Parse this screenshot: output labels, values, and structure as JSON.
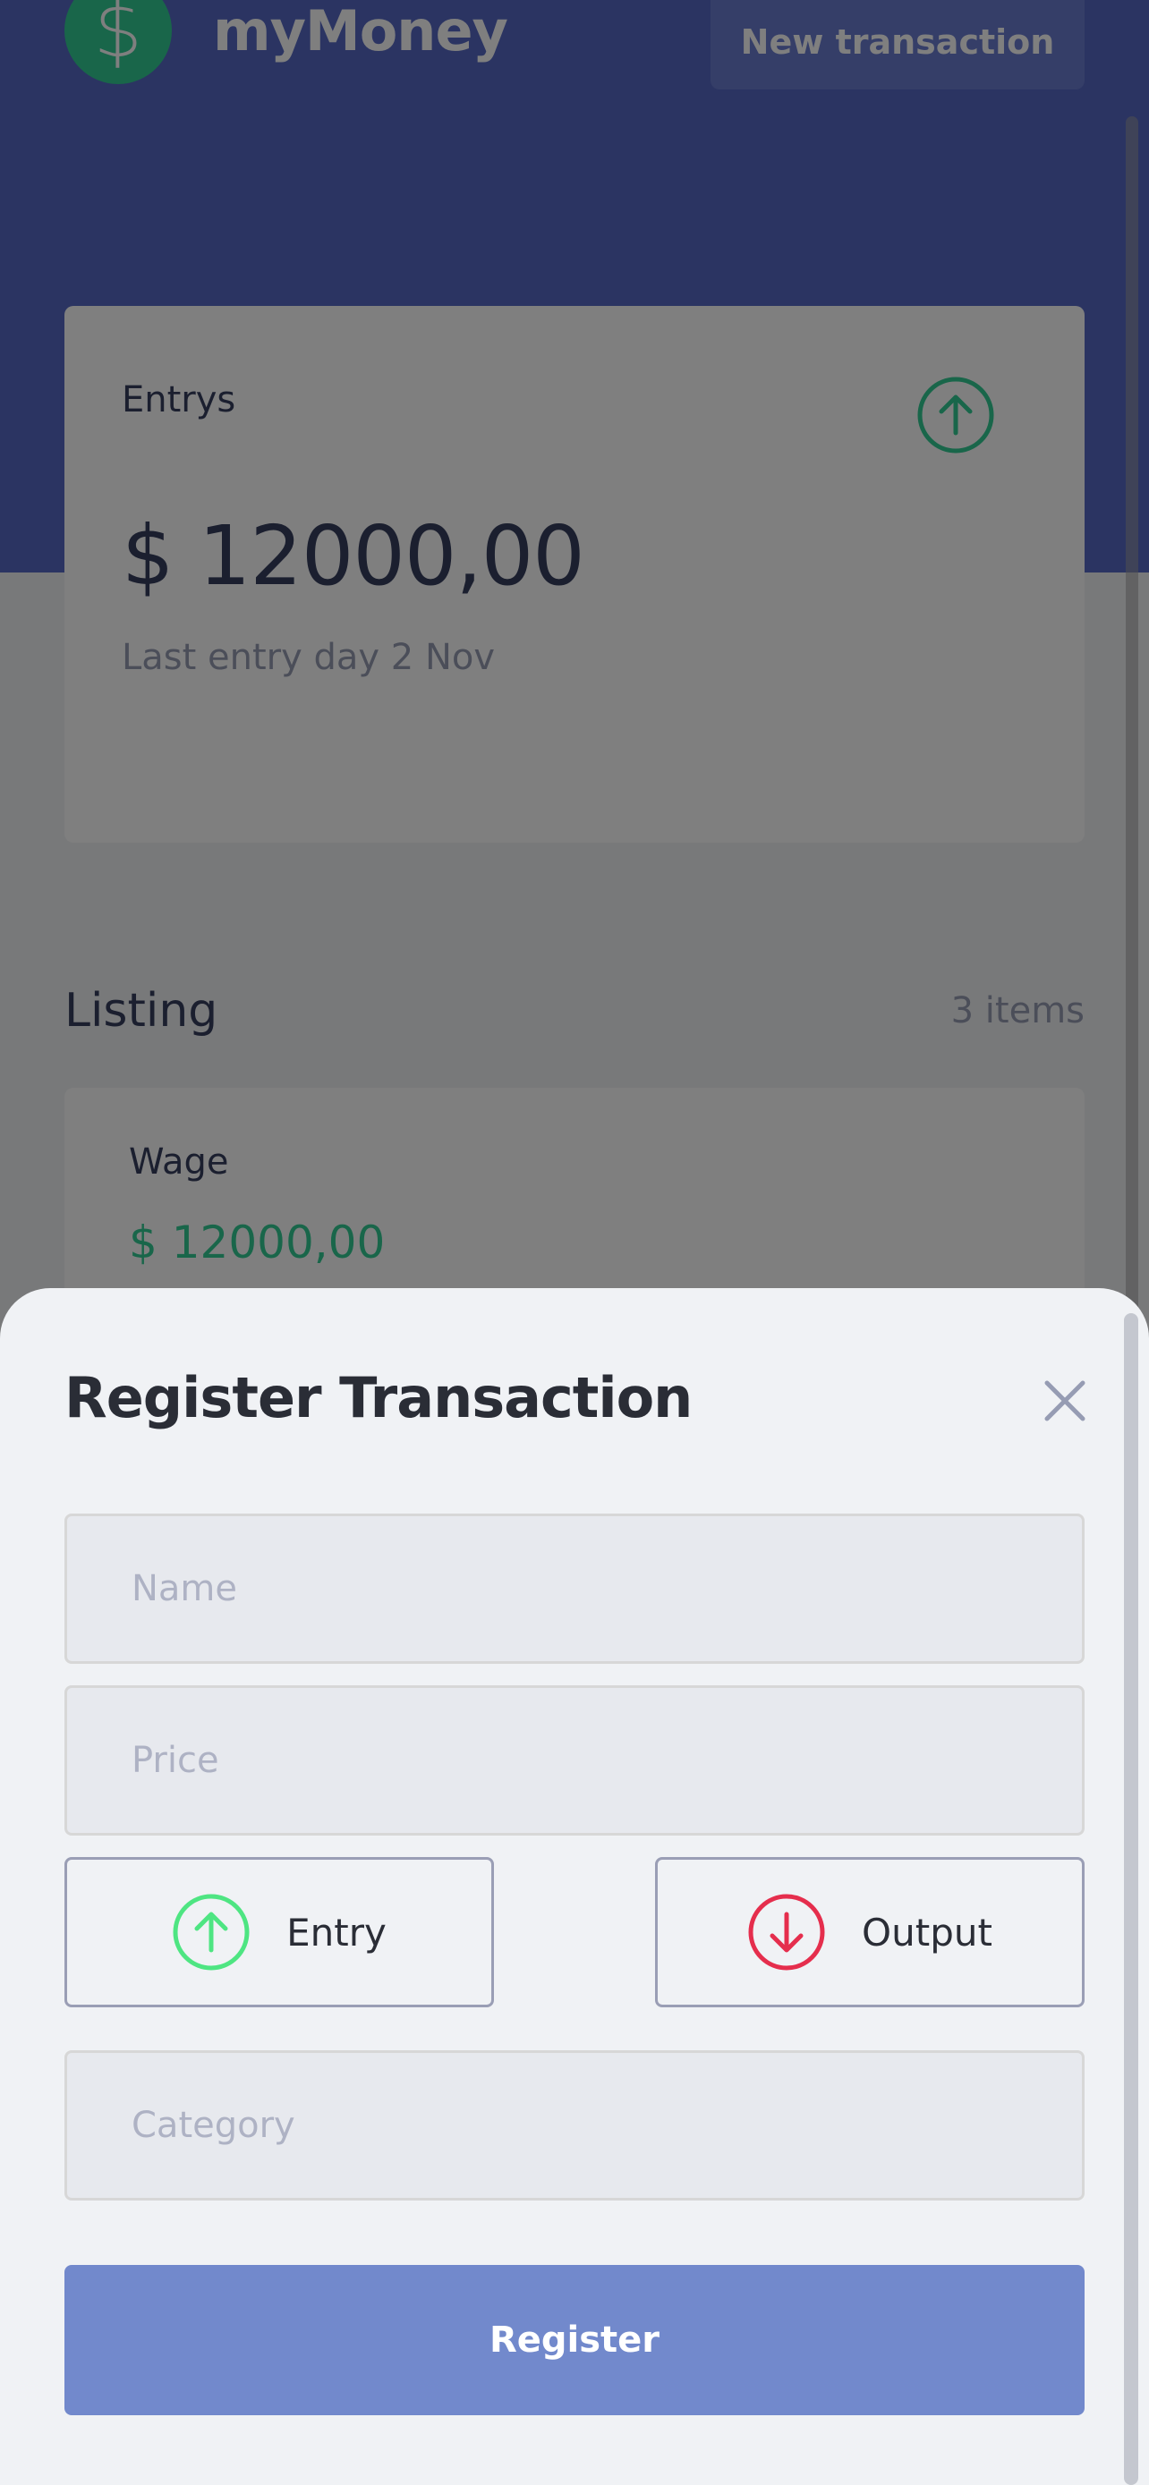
{
  "header": {
    "logo_symbol": "$",
    "app_name": "myMoney",
    "new_transaction_label": "New transaction"
  },
  "summary": {
    "title": "Entrys",
    "amount": "$ 12000,00",
    "last_entry": "Last entry day 2 Nov",
    "icon": "arrow-up-circle-icon"
  },
  "listing": {
    "title": "Listing",
    "count": "3 items",
    "items": [
      {
        "name": "Wage",
        "amount": "$ 12000,00"
      }
    ]
  },
  "modal": {
    "title": "Register Transaction",
    "close_icon": "close-icon",
    "name_placeholder": "Name",
    "price_placeholder": "Price",
    "category_placeholder": "Category",
    "entry_label": "Entry",
    "output_label": "Output",
    "register_label": "Register"
  },
  "colors": {
    "primary": "#5769c4",
    "green": "#33cc95",
    "red": "#e52e4d",
    "register": "#7289cc",
    "background": "#f0f2f5"
  }
}
